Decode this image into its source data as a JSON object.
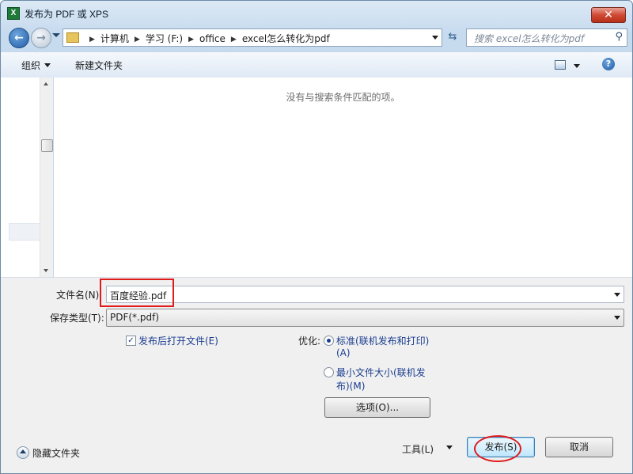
{
  "window": {
    "title": "发布为 PDF 或 XPS",
    "app_icon": "excel-icon",
    "close_label": "✕"
  },
  "nav": {
    "breadcrumbs": [
      "计算机",
      "学习 (F:)",
      "office",
      "excel怎么转化为pdf"
    ],
    "search_placeholder": "搜索 excel怎么转化为pdf"
  },
  "toolbar": {
    "organize_label": "组织",
    "new_folder_label": "新建文件夹"
  },
  "filelist": {
    "empty_message": "没有与搜索条件匹配的项。"
  },
  "form": {
    "filename_label": "文件名(N):",
    "filename_value": "百度经验.pdf",
    "filetype_label": "保存类型(T):",
    "filetype_value": "PDF(*.pdf)",
    "open_after_publish_label": "发布后打开文件(E)",
    "open_after_publish_checked": true,
    "optimize_label": "优化:",
    "optimize_options": [
      {
        "line1": "标准(联机发布和打印)",
        "line2": "(A)",
        "selected": true
      },
      {
        "line1": "最小文件大小(联机发",
        "line2": "布)(M)",
        "selected": false
      }
    ],
    "options_button": "选项(O)..."
  },
  "footer": {
    "hide_folders_label": "隐藏文件夹",
    "tools_label": "工具(L)",
    "publish_button": "发布(S)",
    "cancel_button": "取消"
  },
  "colors": {
    "annotation_red": "#e01b1b",
    "link_blue": "#1a3d8f"
  }
}
